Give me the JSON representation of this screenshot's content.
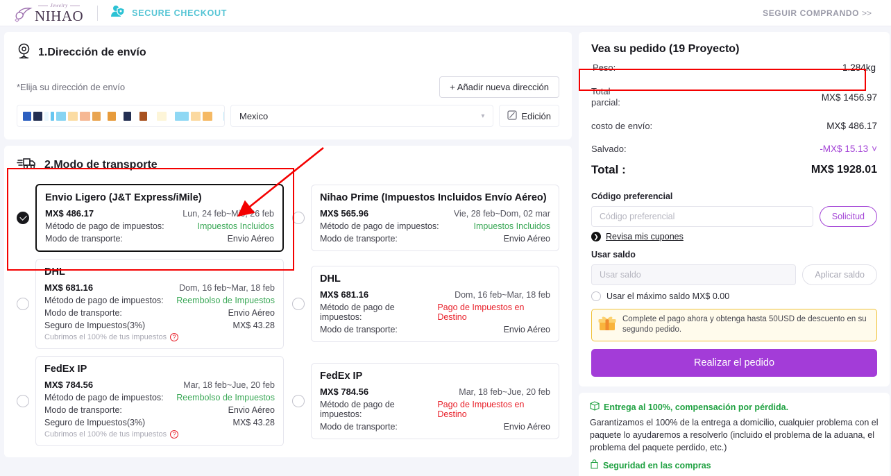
{
  "header": {
    "logo_script": "Jewelry",
    "logo_name": "NIHAO",
    "secure_label": "SECURE CHECKOUT",
    "keep_shopping": "SEGUIR COMPRANDO",
    "keep_shopping_chevron": ">>",
    "icons": {
      "logo": "nihao-logo-icon",
      "secure": "secure-user-shield-icon"
    }
  },
  "address": {
    "title": "1.Dirección de envío",
    "hint": "*Elija su dirección de envío",
    "add_button": "+ Añadir nueva dirección",
    "country": "Mexico",
    "edit_button": "Edición",
    "redacted_blocks": [
      {
        "w": 12,
        "c": "#2c5fc0"
      },
      {
        "w": 13,
        "c": "#232f52"
      },
      {
        "w": 6,
        "c": "#e8f6fd"
      },
      {
        "w": 5,
        "c": "#67c6f0"
      },
      {
        "w": 14,
        "c": "#87d4f2"
      },
      {
        "w": 14,
        "c": "#fbdca3"
      },
      {
        "w": 15,
        "c": "#f6b894"
      },
      {
        "w": 12,
        "c": "#e9a450"
      },
      {
        "w": 4,
        "c": "#ffffff"
      },
      {
        "w": 12,
        "c": "#e79b3b"
      },
      {
        "w": 5,
        "c": "#ffffff"
      },
      {
        "w": 11,
        "c": "#232f52"
      },
      {
        "w": 6,
        "c": "#ffffff"
      },
      {
        "w": 11,
        "c": "#a8511f"
      },
      {
        "w": 8,
        "c": "#ffffff"
      },
      {
        "w": 14,
        "c": "#fdf5d8"
      },
      {
        "w": 6,
        "c": "#ffffff"
      },
      {
        "w": 20,
        "c": "#8fd8f4"
      },
      {
        "w": 14,
        "c": "#fbd9a0"
      },
      {
        "w": 14,
        "c": "#f5b964"
      },
      {
        "w": 10,
        "c": "#ffffff"
      },
      {
        "w": 5,
        "c": "#bfe8f8"
      }
    ]
  },
  "shipping": {
    "title": "2.Modo de transporte",
    "labels": {
      "tax_method": "Método de pago de impuestos:",
      "transport_mode": "Modo de transporte:",
      "tax_insurance": "Seguro de Impuestos(3%)",
      "coverage_note": "Cubrimos el 100% de tus impuestos"
    },
    "options": [
      {
        "name": "Envio Ligero  (J&T Express/iMile)",
        "price": "MX$ 486.17",
        "eta": "Lun, 24 feb~Mie, 26 feb",
        "tax_value": "Impuestos Incluidos",
        "tax_color": "green",
        "inline_tax": false,
        "mode": "Envio Aéreo",
        "insurance": null,
        "note": null,
        "selected": true
      },
      {
        "name": "Nihao Prime (Impuestos Incluidos Envío Aéreo)",
        "price": "MX$ 565.96",
        "eta": "Vie, 28 feb~Dom, 02 mar",
        "tax_value": "Impuestos Incluidos",
        "tax_color": "green",
        "inline_tax": false,
        "mode": "Envio Aéreo",
        "insurance": null,
        "note": null,
        "selected": false
      },
      {
        "name": "DHL",
        "price": "MX$ 681.16",
        "eta": "Dom, 16 feb~Mar, 18 feb",
        "tax_value": "Reembolso de Impuestos",
        "tax_color": "green",
        "inline_tax": false,
        "mode": "Envio Aéreo",
        "insurance": "MX$ 43.28",
        "note": "Cubrimos el 100% de tus impuestos",
        "selected": false
      },
      {
        "name": "DHL",
        "price": "MX$ 681.16",
        "eta": "Dom, 16 feb~Mar, 18 feb",
        "tax_value": "Pago de Impuestos en Destino",
        "tax_color": "red",
        "inline_tax": true,
        "mode": "Envio Aéreo",
        "insurance": null,
        "note": null,
        "selected": false
      },
      {
        "name": "FedEx IP",
        "price": "MX$ 784.56",
        "eta": "Mar, 18 feb~Jue, 20 feb",
        "tax_value": "Reembolso de Impuestos",
        "tax_color": "green",
        "inline_tax": false,
        "mode": "Envio Aéreo",
        "insurance": "MX$ 43.28",
        "note": "Cubrimos el 100% de tus impuestos",
        "selected": false
      },
      {
        "name": "FedEx IP",
        "price": "MX$ 784.56",
        "eta": "Mar, 18 feb~Jue, 20 feb",
        "tax_value": "Pago de Impuestos en Destino",
        "tax_color": "red",
        "inline_tax": true,
        "mode": "Envio Aéreo",
        "insurance": null,
        "note": null,
        "selected": false
      }
    ]
  },
  "summary": {
    "title": "Vea su pedido (19 Proyecto)",
    "weight_label": "Peso:",
    "weight_value": "1.284kg",
    "subtotal_label_l1": "Total",
    "subtotal_label_l2": "parcial:",
    "subtotal_value": "MX$ 1456.97",
    "shipping_label": "costo de envío:",
    "shipping_value": "MX$ 486.17",
    "saved_label": "Salvado:",
    "saved_value": "-MX$ 15.13",
    "total_label": "Total :",
    "total_value": "MX$ 1928.01",
    "coupon_title": "Código preferencial",
    "coupon_placeholder": "Código preferencial",
    "coupon_value": "",
    "coupon_button": "Solicitud",
    "coupon_link": "Revisa mis cupones",
    "balance_title": "Usar saldo",
    "balance_placeholder": "Usar saldo",
    "balance_value": "",
    "balance_button": "Aplicar saldo",
    "max_balance_label": "Usar el máximo saldo MX$ 0.00",
    "promo_text": "Complete el pago ahora y obtenga hasta 50USD de descuento en su segundo pedido.",
    "place_order_button": "Realizar el pedido"
  },
  "guarantee": {
    "head1": "Entrega al 100%, compensación por pérdida.",
    "body": "Garantizamos el 100% de la entrega a domicilio, cualquier problema con el paquete lo ayudaremos a resolverlo (incluido el problema de la aduana, el problema del paquete perdido, etc.)",
    "head2": "Seguridad en las compras"
  },
  "colors": {
    "brand_purple": "#a33cd8",
    "secure_teal": "#54c4d4",
    "green": "#3aa856",
    "red": "#e8202a",
    "annotation_red": "#f40000",
    "promo_border": "#f0c23a"
  }
}
